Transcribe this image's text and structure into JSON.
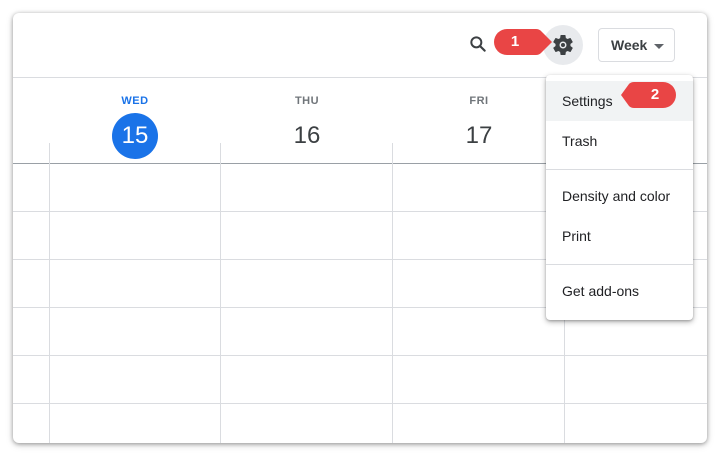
{
  "toolbar": {
    "search_icon": "search-icon",
    "settings_icon": "gear-icon",
    "view_label": "Week"
  },
  "days": [
    {
      "dow": "WED",
      "date": "15",
      "today": true
    },
    {
      "dow": "THU",
      "date": "16",
      "today": false
    },
    {
      "dow": "FRI",
      "date": "17",
      "today": false
    }
  ],
  "settings_menu": {
    "items": [
      "Settings",
      "Trash",
      "Density and color",
      "Print",
      "Get add-ons"
    ],
    "highlighted": "Settings"
  },
  "annotations": [
    {
      "label": "1"
    },
    {
      "label": "2"
    }
  ],
  "colors": {
    "accent": "#1a73e8",
    "callout": "#e94545"
  }
}
